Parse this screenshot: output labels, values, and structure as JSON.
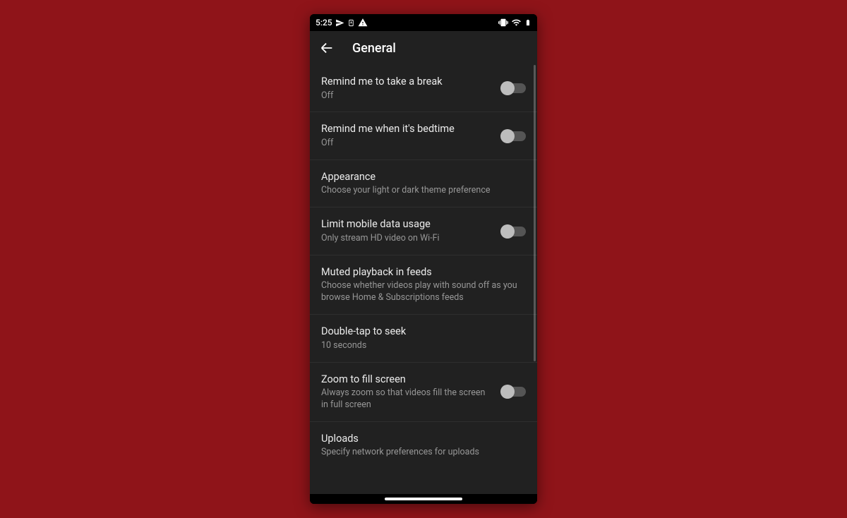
{
  "statusbar": {
    "time": "5:25"
  },
  "header": {
    "title": "General"
  },
  "settings": [
    {
      "title": "Remind me to take a break",
      "subtitle": "Off",
      "toggle": true
    },
    {
      "title": "Remind me when it's bedtime",
      "subtitle": "Off",
      "toggle": true
    },
    {
      "title": "Appearance",
      "subtitle": "Choose your light or dark theme preference",
      "toggle": false
    },
    {
      "title": "Limit mobile data usage",
      "subtitle": "Only stream HD video on Wi-Fi",
      "toggle": true
    },
    {
      "title": "Muted playback in feeds",
      "subtitle": "Choose whether videos play with sound off as you browse Home & Subscriptions feeds",
      "toggle": false
    },
    {
      "title": "Double-tap to seek",
      "subtitle": "10 seconds",
      "toggle": false
    },
    {
      "title": "Zoom to fill screen",
      "subtitle": "Always zoom so that videos fill the screen in full screen",
      "toggle": true
    },
    {
      "title": "Uploads",
      "subtitle": "Specify network preferences for uploads",
      "toggle": false
    }
  ]
}
